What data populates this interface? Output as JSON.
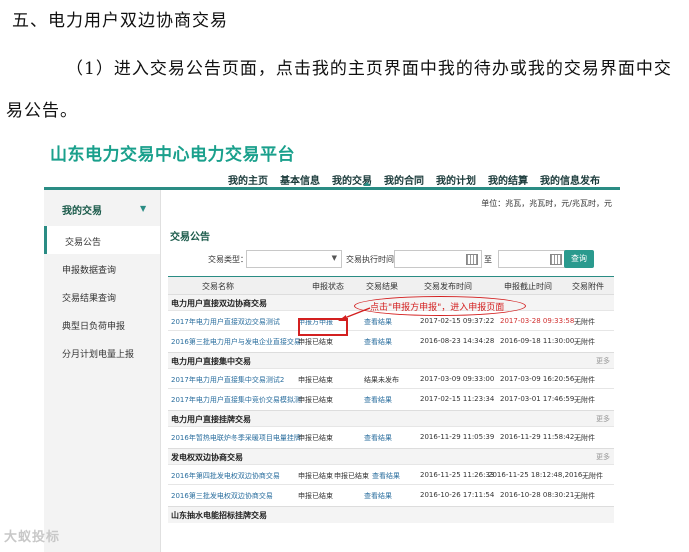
{
  "doc": {
    "heading": "五、电力用户双边协商交易",
    "para": "（1）进入交易公告页面，点击我的主页界面中我的待办或我的交易界面中交易公告。"
  },
  "platform": {
    "title": "山东电力交易中心电力交易平台",
    "title_color": "#1aa08c",
    "accent": "#2a8c84"
  },
  "topnav": [
    "我的主页",
    "基本信息",
    "我的交易",
    "我的合同",
    "我的计划",
    "我的结算",
    "我的信息发布"
  ],
  "sidebar": {
    "header": "我的交易",
    "items": [
      "交易公告",
      "申报数据查询",
      "交易结果查询",
      "典型日负荷申报",
      "分月计划电量上报"
    ]
  },
  "main": {
    "unit_text": "单位：兆瓦，兆瓦时，元/兆瓦时，元",
    "section_title": "交易公告",
    "filter": {
      "type_label": "交易类型：",
      "type_value": "",
      "time_label": "交易执行时间：",
      "to_label": "至",
      "query_button": "查询"
    },
    "columns": [
      "交易名称",
      "申报状态",
      "交易结果",
      "交易发布时间",
      "申报截止时间",
      "交易附件"
    ],
    "more_label": "更多",
    "groups": [
      {
        "name": "电力用户直接双边协商交易",
        "rows": [
          {
            "name": "2017年电力用户直接双边交易测试",
            "status": "申报方申报",
            "result": "查看结果",
            "publish": "2017-02-15 09:37:22",
            "deadline": "2017-03-28 09:33:58",
            "attach": "无附件"
          },
          {
            "name": "2016第三批电力用户与发电企业直接交易",
            "status": "申报已结束",
            "result": "查看结果",
            "publish": "2016-08-23 14:34:28",
            "deadline": "2016-09-18 11:30:00",
            "attach": "无附件"
          }
        ]
      },
      {
        "name": "电力用户直接集中交易",
        "rows": [
          {
            "name": "2017年电力用户直接集中交易测试2",
            "status": "申报已结束",
            "result": "结果未发布",
            "publish": "2017-03-09 09:33:00",
            "deadline": "2017-03-09 16:20:56",
            "attach": "无附件"
          },
          {
            "name": "2017年电力用户直接集中竞价交易模拟测试",
            "status": "申报已结束",
            "result": "查看结果",
            "publish": "2017-02-15 11:23:34",
            "deadline": "2017-03-01 17:46:59",
            "attach": "无附件"
          }
        ]
      },
      {
        "name": "电力用户直接挂牌交易",
        "rows": [
          {
            "name": "2016年暂热电联炉冬季采暖项目电量挂牌交易",
            "status": "申报已结束",
            "result": "查看结果",
            "publish": "2016-11-29 11:05:39",
            "deadline": "2016-11-29 11:58:42",
            "attach": "无附件"
          }
        ]
      },
      {
        "name": "发电权双边协商交易",
        "rows": [
          {
            "name": "2016年第四批发电权双边协商交易",
            "status": "申报已结束",
            "result2": "申报已结束",
            "result": "查看结果",
            "publish": "2016-11-25 11:26:33",
            "deadline": "2016-11-25 18:12:48,2016",
            "attach": "无附件"
          },
          {
            "name": "2016第三批发电权双边协商交易",
            "status": "申报已结束",
            "result": "查看结果",
            "publish": "2016-10-26 17:11:54",
            "deadline": "2016-10-28 08:30:21",
            "attach": "无附件"
          }
        ]
      },
      {
        "name": "山东抽水电能招标挂牌交易",
        "rows": []
      }
    ]
  },
  "annotation": {
    "callout": "点击\"申报方申报\"，进入申报页面",
    "color": "#d32020"
  },
  "watermark": "大蚁投标"
}
